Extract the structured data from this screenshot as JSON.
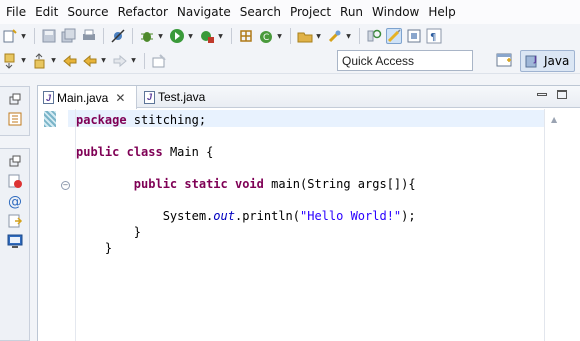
{
  "menu": [
    "File",
    "Edit",
    "Source",
    "Refactor",
    "Navigate",
    "Search",
    "Project",
    "Run",
    "Window",
    "Help"
  ],
  "quick_access": {
    "placeholder": "Quick Access"
  },
  "perspective": {
    "label": "Java"
  },
  "tabs": [
    {
      "label": "Main.java",
      "active": true,
      "close": "✕"
    },
    {
      "label": "Test.java",
      "active": false
    }
  ],
  "code": {
    "line1": {
      "kw": "package",
      "rest": " stitching;"
    },
    "line2": {
      "kw1": "public",
      "kw2": "class",
      "rest": " Main {"
    },
    "line3": {
      "indent": "        ",
      "kw1": "public",
      "kw2": "static",
      "kw3": "void",
      "rest": " main(String args[]){"
    },
    "line4": {
      "indent": "            ",
      "pre": "System.",
      "field": "out",
      "mid": ".println(",
      "str": "\"Hello World!\"",
      "post": ");"
    },
    "line5": "        }",
    "line6": "    }"
  },
  "colors": {
    "keyword": "#7f0055",
    "string": "#2a00ff",
    "field": "#0000c0",
    "current_line": "#e8f2fe"
  }
}
